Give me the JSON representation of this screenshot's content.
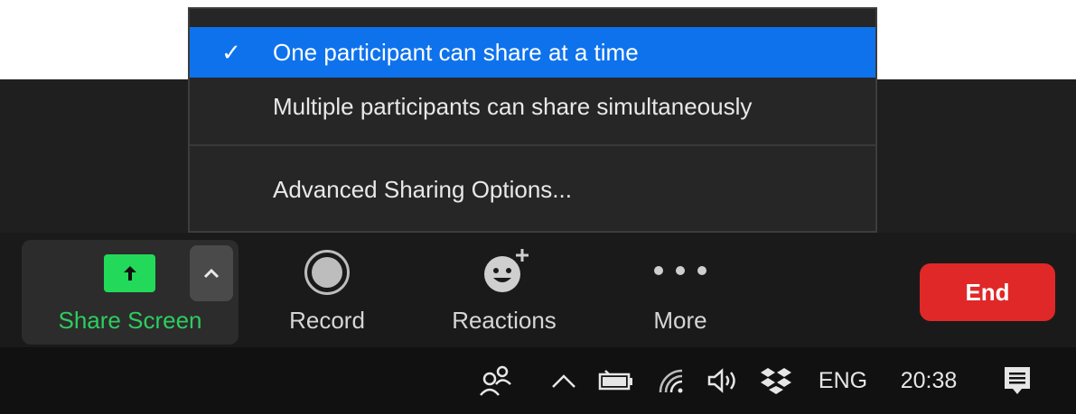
{
  "share_menu": {
    "items": [
      {
        "label": "One participant can share at a time",
        "checked": true,
        "check_glyph": "✓"
      },
      {
        "label": "Multiple participants can share simultaneously",
        "checked": false,
        "check_glyph": ""
      },
      {
        "label": "Advanced Sharing Options...",
        "checked": false,
        "check_glyph": ""
      }
    ]
  },
  "toolbar": {
    "share_label": "Share Screen",
    "record_label": "Record",
    "reactions_label": "Reactions",
    "more_label": "More",
    "end_label": "End"
  },
  "taskbar": {
    "language": "ENG",
    "clock": "20:38"
  },
  "colors": {
    "accent_blue": "#0e72ed",
    "share_green": "#23d959",
    "end_red": "#e02828"
  },
  "icons": [
    "share-arrow-icon",
    "chevron-up-icon",
    "record-icon",
    "reactions-icon",
    "more-icon",
    "people-icon",
    "tray-chevron-icon",
    "battery-icon",
    "wifi-icon",
    "volume-icon",
    "dropbox-icon",
    "notifications-icon"
  ]
}
